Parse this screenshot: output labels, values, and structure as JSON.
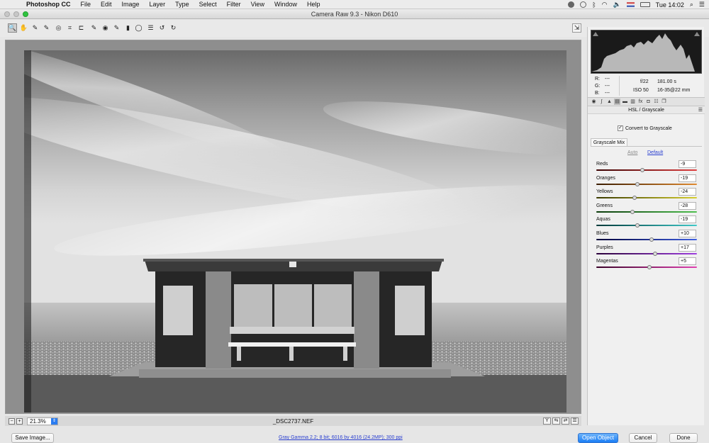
{
  "menubar": {
    "app": "Photoshop CC",
    "items": [
      "File",
      "Edit",
      "Image",
      "Layer",
      "Type",
      "Select",
      "Filter",
      "View",
      "Window",
      "Help"
    ],
    "clock": "Tue 14:02"
  },
  "window": {
    "title": "Camera Raw 9.3  -  Nikon D610"
  },
  "toolbar": {
    "tools": [
      {
        "name": "zoom-tool",
        "glyph": "🔍"
      },
      {
        "name": "hand-tool",
        "glyph": "✋"
      },
      {
        "name": "white-balance-tool",
        "glyph": "✎"
      },
      {
        "name": "color-sampler-tool",
        "glyph": "✎"
      },
      {
        "name": "targeted-adjustment-tool",
        "glyph": "◎"
      },
      {
        "name": "crop-tool",
        "glyph": "⌗"
      },
      {
        "name": "straighten-tool",
        "glyph": "⊏"
      },
      {
        "name": "spot-removal-tool",
        "glyph": "✎"
      },
      {
        "name": "red-eye-tool",
        "glyph": "◉"
      },
      {
        "name": "adjustment-brush-tool",
        "glyph": "✎"
      },
      {
        "name": "graduated-filter-tool",
        "glyph": "▮"
      },
      {
        "name": "radial-filter-tool",
        "glyph": "◯"
      },
      {
        "name": "preferences-tool",
        "glyph": "☰"
      },
      {
        "name": "rotate-left-tool",
        "glyph": "↺"
      },
      {
        "name": "rotate-right-tool",
        "glyph": "↻"
      }
    ]
  },
  "preview": {
    "zoom": "21.3%",
    "filename": "_DSC2737.NEF"
  },
  "meta": {
    "r_label": "R:",
    "r_val": "---",
    "g_label": "G:",
    "g_val": "---",
    "b_label": "B:",
    "b_val": "---",
    "aperture": "f/22",
    "shutter": "181.00 s",
    "iso": "ISO 50",
    "lens": "16-35@22 mm"
  },
  "panel": {
    "section_title": "HSL / Grayscale",
    "convert_label": "Convert to Grayscale",
    "convert_checked": true,
    "tab_label": "Grayscale Mix",
    "auto_label": "Auto",
    "default_label": "Default",
    "sliders": [
      {
        "label": "Reds",
        "value": "-9",
        "num": -9,
        "gradient": "linear-gradient(90deg,#3a0000,#e04040)"
      },
      {
        "label": "Oranges",
        "value": "-19",
        "num": -19,
        "gradient": "linear-gradient(90deg,#3a1c00,#e08a30)"
      },
      {
        "label": "Yellows",
        "value": "-24",
        "num": -24,
        "gradient": "linear-gradient(90deg,#3a3a00,#d8d030)"
      },
      {
        "label": "Greens",
        "value": "-28",
        "num": -28,
        "gradient": "linear-gradient(90deg,#0a3a0a,#4fc04f)"
      },
      {
        "label": "Aquas",
        "value": "-19",
        "num": -19,
        "gradient": "linear-gradient(90deg,#003a3a,#40c8c8)"
      },
      {
        "label": "Blues",
        "value": "+10",
        "num": 10,
        "gradient": "linear-gradient(90deg,#00003a,#4060e0)"
      },
      {
        "label": "Purples",
        "value": "+17",
        "num": 17,
        "gradient": "linear-gradient(90deg,#2a003a,#a040e0)"
      },
      {
        "label": "Magentas",
        "value": "+5",
        "num": 5,
        "gradient": "linear-gradient(90deg,#3a0028,#e040b0)"
      }
    ]
  },
  "bottom": {
    "save_label": "Save Image...",
    "workflow_link": "Gray Gamma 2.2; 8 bit; 6016 by 4016 (24.2MP); 300 ppi",
    "open_label": "Open Object",
    "cancel_label": "Cancel",
    "done_label": "Done"
  },
  "colors": {
    "accent": "#1b7ef5",
    "link": "#2a3fd0"
  }
}
